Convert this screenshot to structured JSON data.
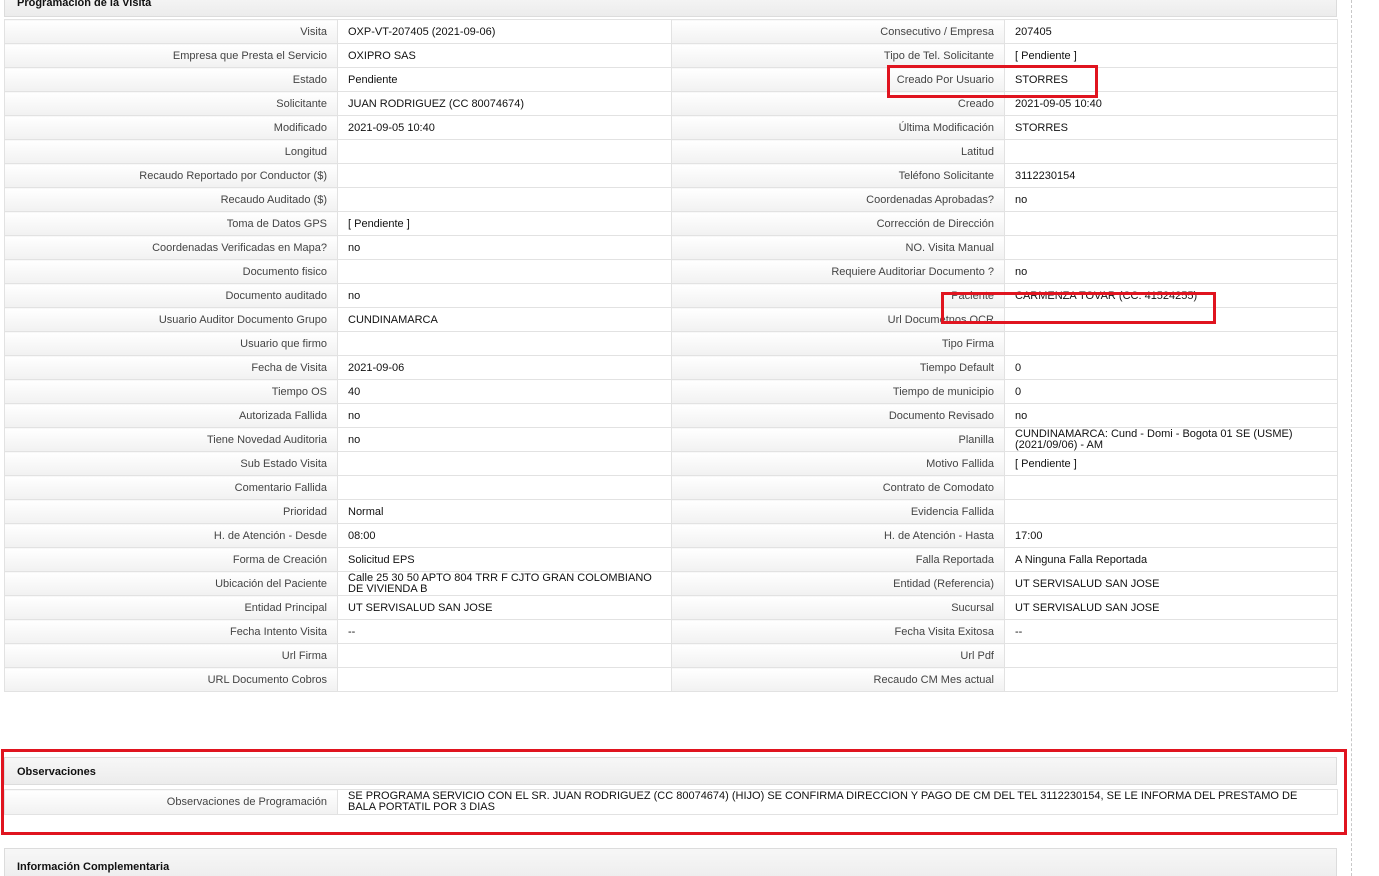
{
  "main_section": {
    "title": "Programación de la Visita",
    "rows": [
      {
        "l1": "Visita",
        "v1": "OXP-VT-207405 (2021-09-06)",
        "l2": "Consecutivo / Empresa",
        "v2": "207405"
      },
      {
        "l1": "Empresa que Presta el Servicio",
        "v1": "OXIPRO SAS",
        "l2": "Tipo de Tel. Solicitante",
        "v2": "[ Pendiente ]"
      },
      {
        "l1": "Estado",
        "v1": "Pendiente",
        "l2": "Creado Por Usuario",
        "v2": "STORRES"
      },
      {
        "l1": "Solicitante",
        "v1": "JUAN RODRIGUEZ (CC 80074674)",
        "l2": "Creado",
        "v2": "2021-09-05 10:40"
      },
      {
        "l1": "Modificado",
        "v1": "2021-09-05 10:40",
        "l2": "Última Modificación",
        "v2": " STORRES"
      },
      {
        "l1": "Longitud",
        "v1": "",
        "l2": "Latitud",
        "v2": ""
      },
      {
        "l1": "Recaudo Reportado por Conductor ($)",
        "v1": "",
        "l2": "Teléfono Solicitante",
        "v2": "3112230154"
      },
      {
        "l1": "Recaudo Auditado ($)",
        "v1": "",
        "l2": "Coordenadas Aprobadas?",
        "v2": " no"
      },
      {
        "l1": "Toma de Datos GPS",
        "v1": "[ Pendiente ]",
        "l2": "Corrección de Dirección",
        "v2": ""
      },
      {
        "l1": "Coordenadas Verificadas en Mapa?",
        "v1": " no",
        "l2": "NO. Visita Manual",
        "v2": ""
      },
      {
        "l1": "Documento fisico",
        "v1": "",
        "l2": "Requiere Auditoriar Documento ?",
        "v2": " no"
      },
      {
        "l1": "Documento auditado",
        "v1": " no",
        "l2": "Paciente",
        "v2": "CARMENZA TOVAR (CC: 41524255)"
      },
      {
        "l1": "Usuario Auditor Documento Grupo",
        "v1": "CUNDINAMARCA",
        "l2": "Url Documetnos OCR",
        "v2": ""
      },
      {
        "l1": "Usuario que firmo",
        "v1": "",
        "l2": "Tipo Firma",
        "v2": ""
      },
      {
        "l1": "Fecha de Visita",
        "v1": " 2021-09-06",
        "l2": "Tiempo Default",
        "v2": "0"
      },
      {
        "l1": "Tiempo OS",
        "v1": "40",
        "l2": "Tiempo de municipio",
        "v2": "0"
      },
      {
        "l1": "Autorizada Fallida",
        "v1": " no",
        "l2": "Documento Revisado",
        "v2": " no"
      },
      {
        "l1": "Tiene Novedad Auditoria",
        "v1": " no",
        "l2": "Planilla",
        "v2": "CUNDINAMARCA: Cund - Domi - Bogota 01 SE (USME) (2021/09/06) - AM"
      },
      {
        "l1": "Sub Estado Visita",
        "v1": "",
        "l2": "Motivo Fallida",
        "v2": "[ Pendiente ]"
      },
      {
        "l1": "Comentario Fallida",
        "v1": "",
        "l2": "Contrato de Comodato",
        "v2": ""
      },
      {
        "l1": "Prioridad",
        "v1": "Normal",
        "l2": "Evidencia Fallida",
        "v2": ""
      },
      {
        "l1": "H. de Atención - Desde",
        "v1": "08:00",
        "l2": "H. de Atención - Hasta",
        "v2": " 17:00"
      },
      {
        "l1": "Forma de Creación",
        "v1": "Solicitud EPS",
        "l2": "Falla Reportada",
        "v2": "A Ninguna Falla Reportada"
      },
      {
        "l1": "Ubicación del Paciente",
        "v1": "Calle 25 30 50 APTO 804 TRR F CJTO GRAN COLOMBIANO DE VIVIENDA B",
        "l2": "Entidad (Referencia)",
        "v2": "UT SERVISALUD SAN JOSE"
      },
      {
        "l1": "Entidad Principal",
        "v1": "UT SERVISALUD SAN JOSE",
        "l2": "Sucursal",
        "v2": "UT SERVISALUD SAN JOSE"
      },
      {
        "l1": "Fecha Intento Visita",
        "v1": " --",
        "l2": "Fecha Visita Exitosa",
        "v2": " --"
      },
      {
        "l1": "Url Firma",
        "v1": "",
        "l2": "Url Pdf",
        "v2": ""
      },
      {
        "l1": "URL Documento Cobros",
        "v1": "",
        "l2": "Recaudo CM Mes actual",
        "v2": ""
      }
    ]
  },
  "observaciones": {
    "title": "Observaciones",
    "label": "Observaciones de Programación",
    "text": "  SE PROGRAMA SERVICIO CON EL SR. JUAN RODRIGUEZ (CC 80074674) (HIJO) SE CONFIRMA DIRECCION Y PAGO DE CM DEL TEL 3112230154, SE LE INFORMA DEL PRESTAMO DE BALA PORTATIL POR 3 DIAS"
  },
  "info_complementaria": {
    "title": "Información Complementaria"
  },
  "colors": {
    "highlight": "#e0141f",
    "label_text": "#444444",
    "border": "#e2e2e2"
  }
}
